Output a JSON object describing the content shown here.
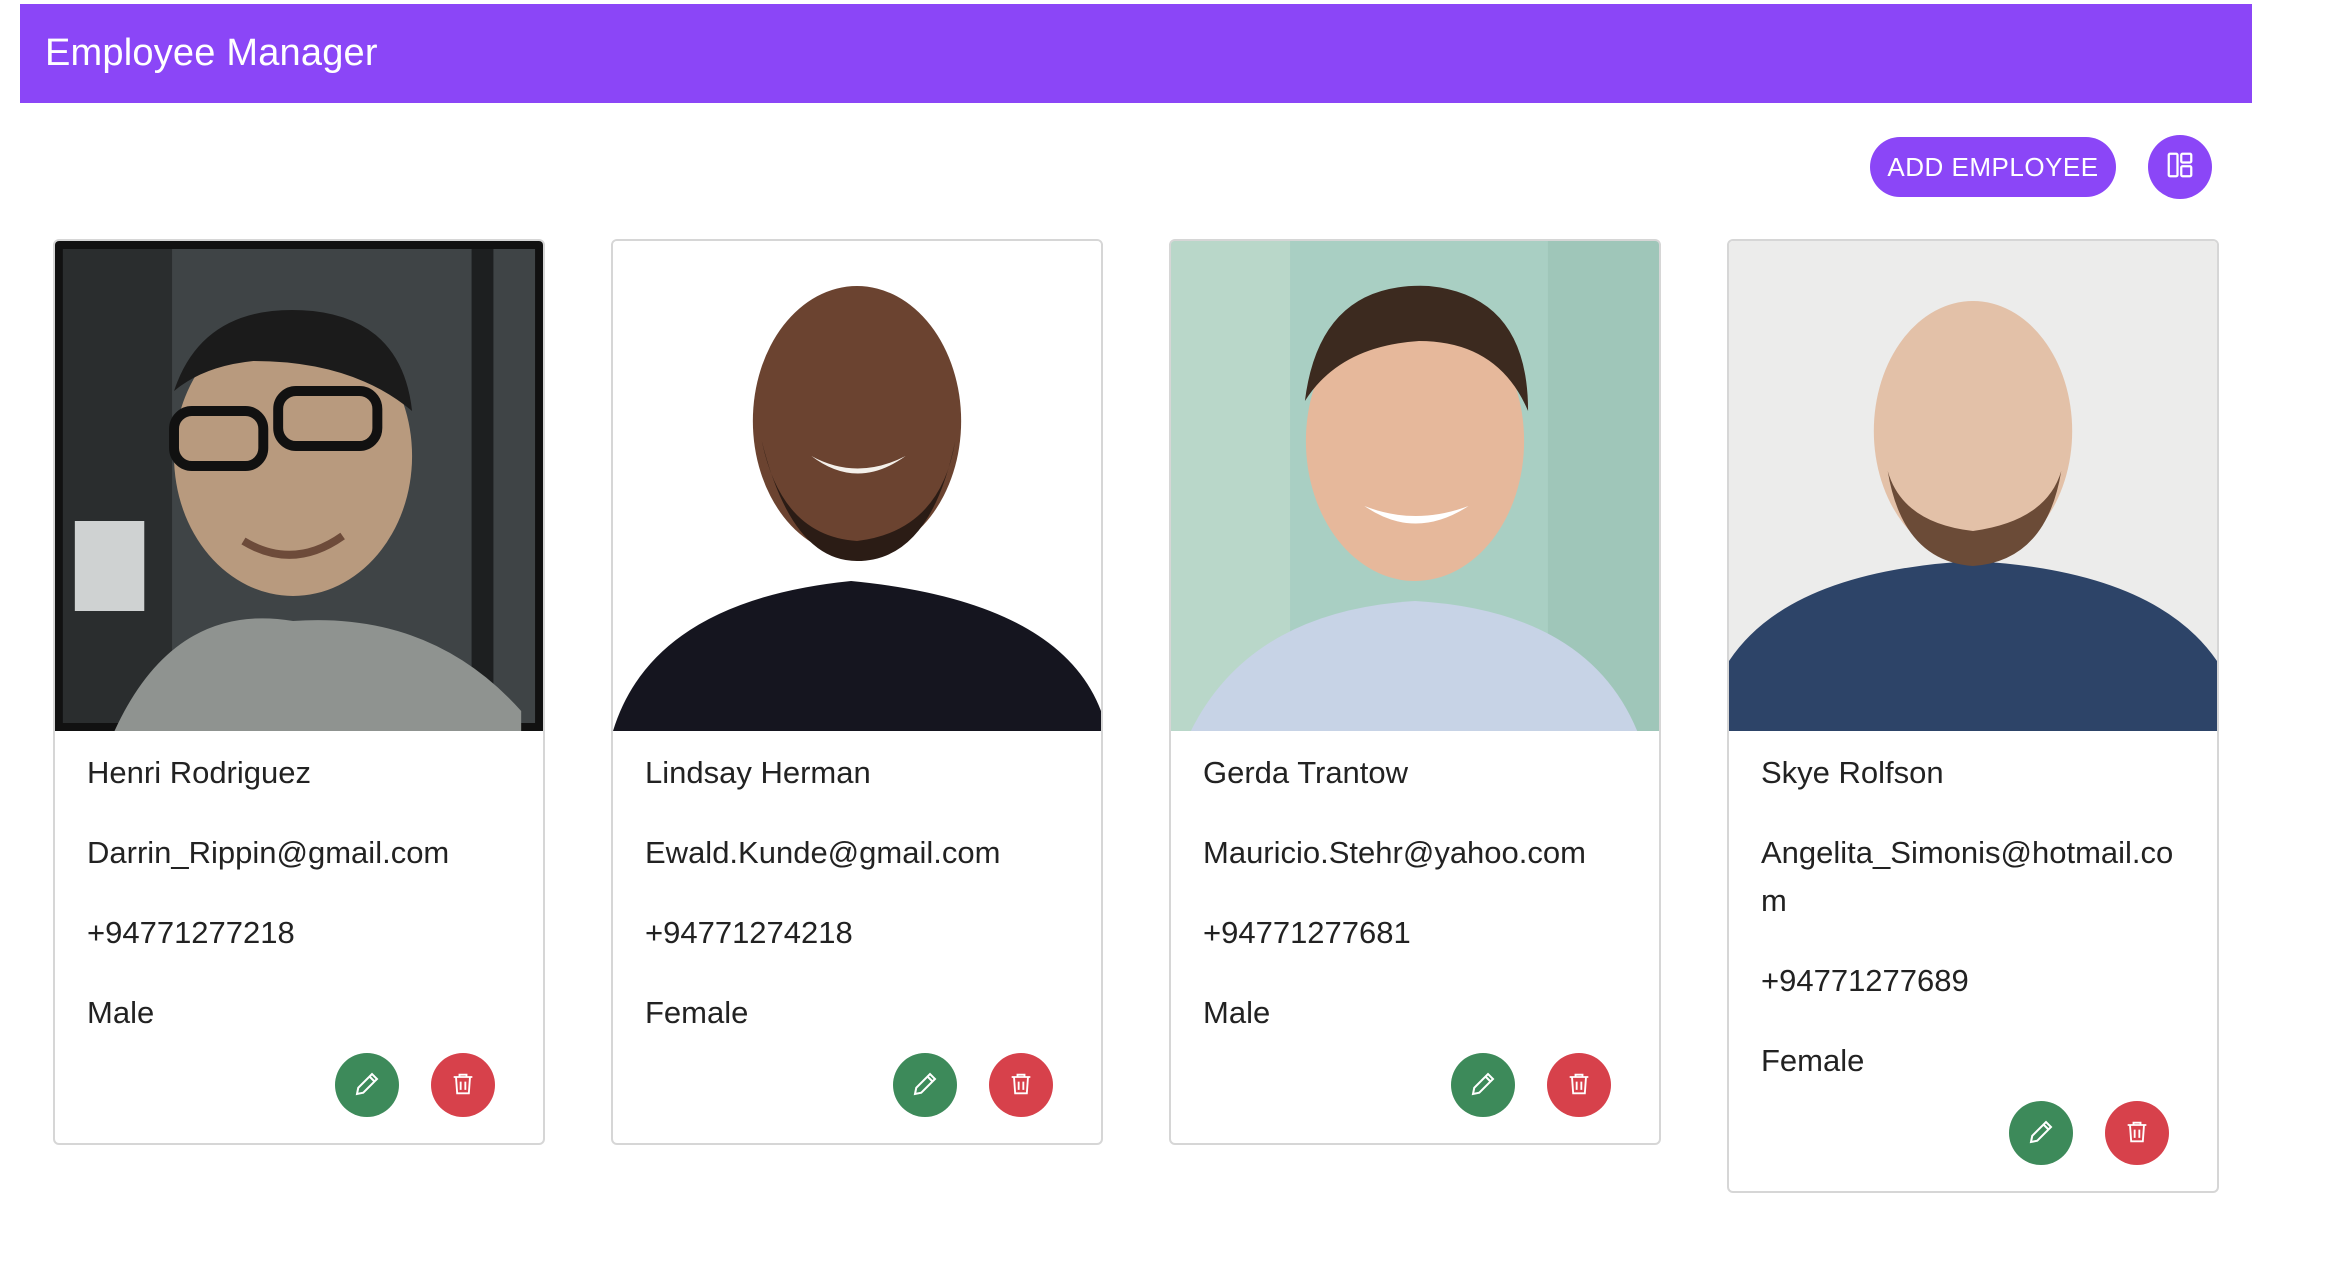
{
  "app": {
    "title": "Employee Manager"
  },
  "toolbar": {
    "add_label": "ADD EMPLOYEE",
    "layout_toggle_icon": "grid-view-icon"
  },
  "colors": {
    "primary": "#8b46f7",
    "edit": "#3d8a5a",
    "delete": "#d7414b"
  },
  "employees": [
    {
      "name": "Henri Rodriguez",
      "email": "Darrin_Rippin@gmail.com",
      "phone": "+94771277218",
      "gender": "Male"
    },
    {
      "name": "Lindsay Herman",
      "email": "Ewald.Kunde@gmail.com",
      "phone": "+94771274218",
      "gender": "Female"
    },
    {
      "name": "Gerda Trantow",
      "email": "Mauricio.Stehr@yahoo.com",
      "phone": "+94771277681",
      "gender": "Male"
    },
    {
      "name": "Skye Rolfson",
      "email": "Angelita_Simonis@hotmail.com",
      "phone": "+94771277689",
      "gender": "Female"
    }
  ]
}
